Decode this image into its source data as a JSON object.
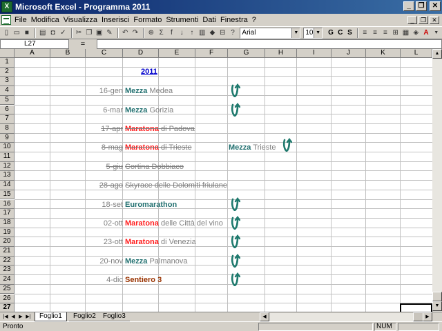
{
  "window": {
    "title": "Microsoft Excel - Programma 2011",
    "app_icon": "X",
    "minimize": "_",
    "restore": "❐",
    "close": "✕"
  },
  "menu": [
    "File",
    "Modifica",
    "Visualizza",
    "Inserisci",
    "Formato",
    "Strumenti",
    "Dati",
    "Finestra",
    "?"
  ],
  "toolbar": {
    "font_name": "Arial",
    "font_size": "10",
    "bold": "G",
    "italic": "C",
    "underline": "S",
    "sum": "Σ",
    "fx": "f",
    "zoom_icon": "?"
  },
  "formula": {
    "cell_ref": "L27",
    "equals": "=",
    "value": ""
  },
  "columns": [
    "A",
    "B",
    "C",
    "D",
    "E",
    "F",
    "G",
    "H",
    "I",
    "J",
    "K",
    "L"
  ],
  "rows": [
    "1",
    "2",
    "3",
    "4",
    "5",
    "6",
    "7",
    "8",
    "9",
    "10",
    "11",
    "12",
    "13",
    "14",
    "15",
    "16",
    "17",
    "18",
    "19",
    "20",
    "21",
    "22",
    "23",
    "24",
    "25",
    "26",
    "27"
  ],
  "cells": {
    "year": "2011",
    "events": [
      {
        "row": 4,
        "date": "16-gen",
        "kind": "Mezza",
        "place": "Medea",
        "style": "teal",
        "strike": false,
        "check": true
      },
      {
        "row": 6,
        "date": "6-mar",
        "kind": "Mezza",
        "place": "Gorizia",
        "style": "teal",
        "strike": false,
        "check": true
      },
      {
        "row": 8,
        "date": "17-apr",
        "kind": "Maratona",
        "place": "di Padova",
        "style": "red",
        "strike": true,
        "check": false
      },
      {
        "row": 10,
        "date": "8-mag",
        "kind": "Maratona",
        "place": "di Trieste",
        "style": "red",
        "strike": true,
        "check": false
      },
      {
        "row": 12,
        "date": "5-giu",
        "kind": "",
        "place": "Cortina Dobbiaco",
        "style": "gray",
        "strike": true,
        "check": false
      },
      {
        "row": 14,
        "date": "28-ago",
        "kind": "",
        "place": "Skyrace delle Dolomiti friulane",
        "style": "gray",
        "strike": true,
        "check": false
      },
      {
        "row": 16,
        "date": "18-set",
        "kind": "Euromarathon",
        "place": "",
        "style": "teal",
        "strike": false,
        "check": true
      },
      {
        "row": 18,
        "date": "02-ott",
        "kind": "Maratona",
        "place": "delle Città del vino",
        "style": "red",
        "strike": false,
        "check": true
      },
      {
        "row": 20,
        "date": "23-ott",
        "kind": "Maratona",
        "place": "di Venezia",
        "style": "red",
        "strike": false,
        "check": true
      },
      {
        "row": 22,
        "date": "20-nov",
        "kind": "Mezza",
        "place": "Palmanova",
        "style": "teal",
        "strike": false,
        "check": true
      },
      {
        "row": 24,
        "date": "4-dic",
        "kind": "Sentiero 3",
        "place": "",
        "style": "maroon",
        "strike": false,
        "check": true
      }
    ],
    "alt_event": {
      "kind": "Mezza",
      "place": "Trieste",
      "check": true
    }
  },
  "sheets": [
    "Foglio1",
    "Foglio2",
    "Foglio3"
  ],
  "active_sheet": "Foglio1",
  "status": {
    "text": "Pronto",
    "num": "NUM"
  },
  "colors": {
    "teal": "#227070",
    "red": "#ff2020",
    "maroon": "#993300",
    "check_arrow": "#1f7a6e"
  }
}
